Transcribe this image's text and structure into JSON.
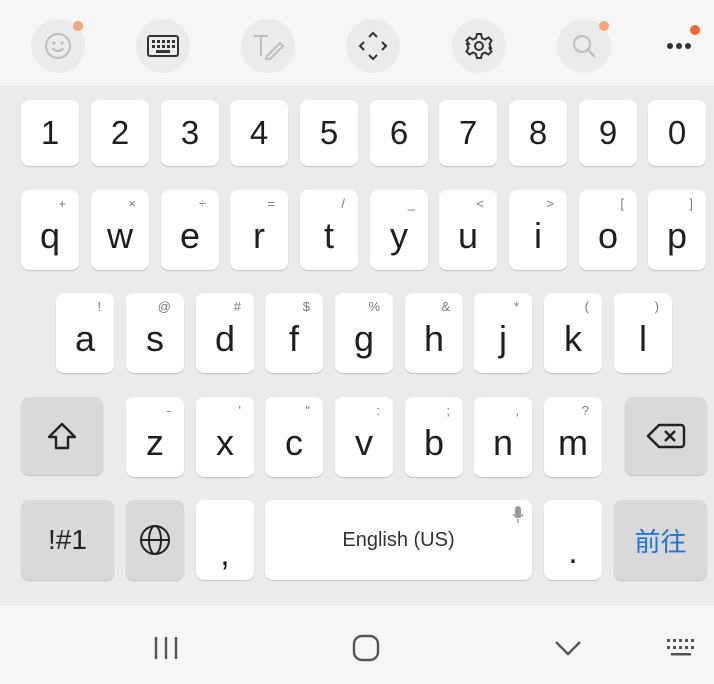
{
  "toolbar": {
    "items": [
      "emoji-icon",
      "keyboard-icon",
      "handwriting-icon",
      "move-cursor-icon",
      "settings-icon",
      "search-icon",
      "more-icon"
    ],
    "notification_color": "#ee6a2d"
  },
  "keyboard": {
    "digits": [
      "1",
      "2",
      "3",
      "4",
      "5",
      "6",
      "7",
      "8",
      "9",
      "0"
    ],
    "row1": [
      {
        "key": "q",
        "alt": "+"
      },
      {
        "key": "w",
        "alt": "×"
      },
      {
        "key": "e",
        "alt": "÷"
      },
      {
        "key": "r",
        "alt": "="
      },
      {
        "key": "t",
        "alt": "/"
      },
      {
        "key": "y",
        "alt": "_"
      },
      {
        "key": "u",
        "alt": "<"
      },
      {
        "key": "i",
        "alt": ">"
      },
      {
        "key": "o",
        "alt": "["
      },
      {
        "key": "p",
        "alt": "]"
      }
    ],
    "row2": [
      {
        "key": "a",
        "alt": "!"
      },
      {
        "key": "s",
        "alt": "@"
      },
      {
        "key": "d",
        "alt": "#"
      },
      {
        "key": "f",
        "alt": "$"
      },
      {
        "key": "g",
        "alt": "%"
      },
      {
        "key": "h",
        "alt": "&"
      },
      {
        "key": "j",
        "alt": "*"
      },
      {
        "key": "k",
        "alt": "("
      },
      {
        "key": "l",
        "alt": ")"
      }
    ],
    "row3": [
      {
        "key": "z",
        "alt": "-"
      },
      {
        "key": "x",
        "alt": "'"
      },
      {
        "key": "c",
        "alt": "\""
      },
      {
        "key": "v",
        "alt": ":"
      },
      {
        "key": "b",
        "alt": ";"
      },
      {
        "key": "n",
        "alt": ","
      },
      {
        "key": "m",
        "alt": "?"
      }
    ],
    "symbols_label": "!#1",
    "comma": ",",
    "space_label": "English (US)",
    "period": ".",
    "go_label": "前往",
    "accent_color": "#1b74e0"
  },
  "navbar": {
    "items": [
      "recent-apps-icon",
      "home-icon",
      "back-icon",
      "keyboard-switch-icon"
    ]
  }
}
